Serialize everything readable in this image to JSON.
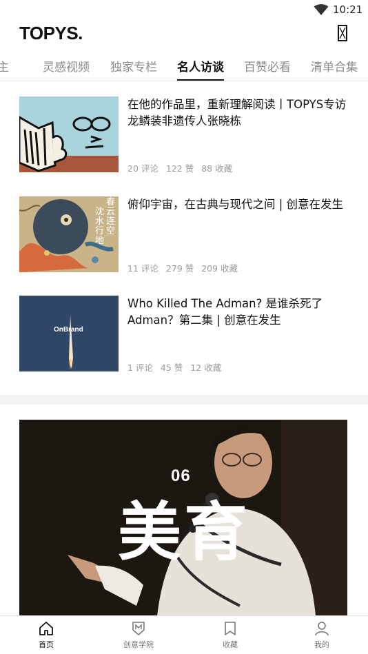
{
  "status_bar": {
    "time": "10:21"
  },
  "header": {
    "logo": "TOPYS."
  },
  "tabs": [
    {
      "label": "主"
    },
    {
      "label": "灵感视频"
    },
    {
      "label": "独家专栏"
    },
    {
      "label": "名人访谈",
      "active": true
    },
    {
      "label": "百赞必看"
    },
    {
      "label": "清单合集"
    }
  ],
  "articles": [
    {
      "title": "在他的作品里，重新理解阅读丨TOPYS专访龙鳞装非遗传人张晓栋",
      "comments": "20 评论",
      "likes": "122 赞",
      "favorites": "88 收藏"
    },
    {
      "title": "俯仰宇宙，在古典与现代之间 | 创意在发生",
      "thumb_text_1": "春云连空",
      "thumb_text_2": "沈水行地",
      "comments": "11 评论",
      "likes": "279 赞",
      "favorites": "209 收藏"
    },
    {
      "title": "Who Killed The Adman? 是谁杀死了Adman？第二集 | 创意在发生",
      "thumb_text": "OnBrand",
      "comments": "1 评论",
      "likes": "45 赞",
      "favorites": "12 收藏"
    }
  ],
  "hero": {
    "number": "06",
    "title": "美育"
  },
  "bottom_nav": [
    {
      "label": "首页",
      "icon": "home-icon",
      "active": true
    },
    {
      "label": "创意学院",
      "icon": "academy-shield-icon"
    },
    {
      "label": "收藏",
      "icon": "bookmark-icon"
    },
    {
      "label": "我的",
      "icon": "user-icon"
    }
  ],
  "colors": {
    "accent": "#111111",
    "meta": "#9a9a9a",
    "tab_inactive": "#8a8a8a"
  }
}
